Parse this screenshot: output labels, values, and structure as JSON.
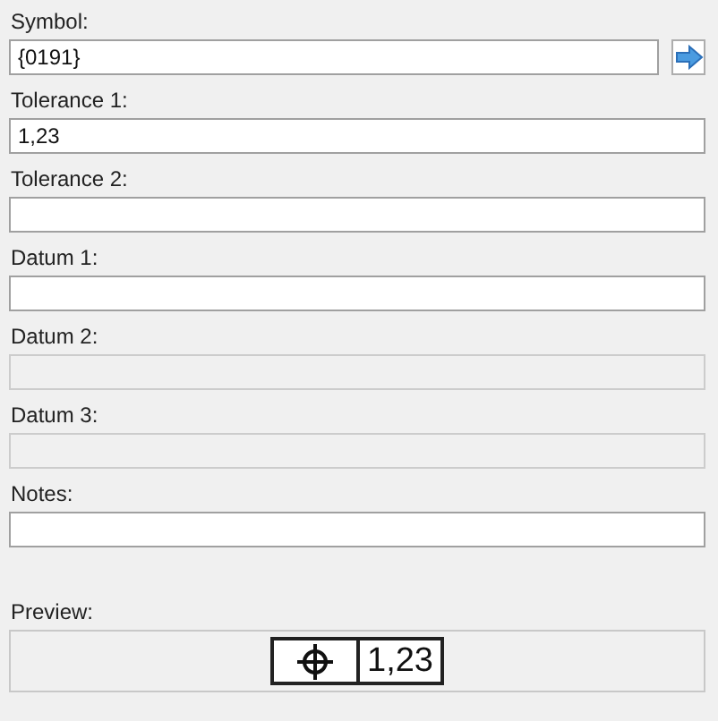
{
  "fields": [
    {
      "label": "Symbol:",
      "value": "{0191}",
      "disabled": false,
      "kind": "symbol"
    },
    {
      "label": "Tolerance 1:",
      "value": "1,23",
      "disabled": false,
      "kind": "text"
    },
    {
      "label": "Tolerance 2:",
      "disabled": false,
      "kind": "text"
    },
    {
      "label": "Datum 1:",
      "disabled": false,
      "kind": "text"
    },
    {
      "label": "Datum 2:",
      "disabled": true,
      "kind": "text"
    },
    {
      "label": "Datum 3:",
      "disabled": true,
      "kind": "text"
    },
    {
      "label": "Notes:",
      "disabled": false,
      "kind": "text"
    }
  ],
  "preview": {
    "label": "Preview:",
    "tolerance": "1,23"
  }
}
